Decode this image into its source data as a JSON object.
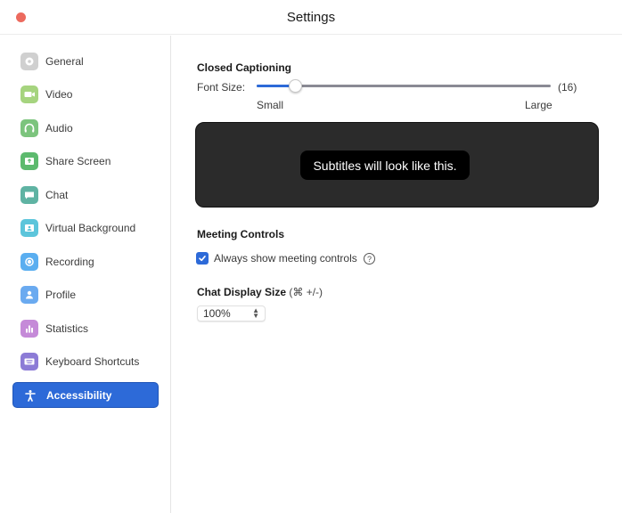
{
  "window": {
    "title": "Settings"
  },
  "sidebar": {
    "items": [
      {
        "label": "General",
        "icon": "gear-icon",
        "color": "#d0d0d0",
        "active": false
      },
      {
        "label": "Video",
        "icon": "video-icon",
        "color": "#a6d47f",
        "active": false
      },
      {
        "label": "Audio",
        "icon": "headphones-icon",
        "color": "#7cc47d",
        "active": false
      },
      {
        "label": "Share Screen",
        "icon": "share-screen-icon",
        "color": "#5dba6e",
        "active": false
      },
      {
        "label": "Chat",
        "icon": "chat-icon",
        "color": "#5fb3a3",
        "active": false
      },
      {
        "label": "Virtual Background",
        "icon": "virtual-background-icon",
        "color": "#5cc5db",
        "active": false
      },
      {
        "label": "Recording",
        "icon": "recording-icon",
        "color": "#5aaef0",
        "active": false
      },
      {
        "label": "Profile",
        "icon": "profile-icon",
        "color": "#6aaaf0",
        "active": false
      },
      {
        "label": "Statistics",
        "icon": "statistics-icon",
        "color": "#c58ad8",
        "active": false
      },
      {
        "label": "Keyboard Shortcuts",
        "icon": "keyboard-icon",
        "color": "#8c7bd6",
        "active": false
      },
      {
        "label": "Accessibility",
        "icon": "accessibility-icon",
        "color": "#2d6ad8",
        "active": true
      }
    ]
  },
  "closed_captioning": {
    "heading": "Closed Captioning",
    "font_size_label": "Font Size:",
    "font_size_value": "(16)",
    "slider_fraction": 0.13,
    "min_label": "Small",
    "max_label": "Large",
    "preview_text": "Subtitles will look like this."
  },
  "meeting_controls": {
    "heading": "Meeting Controls",
    "checkbox_label": "Always show meeting controls",
    "checked": true,
    "help_glyph": "?"
  },
  "chat_display": {
    "heading": "Chat Display Size",
    "shortcut_hint": "(⌘ +/-)",
    "selected_value": "100%"
  }
}
